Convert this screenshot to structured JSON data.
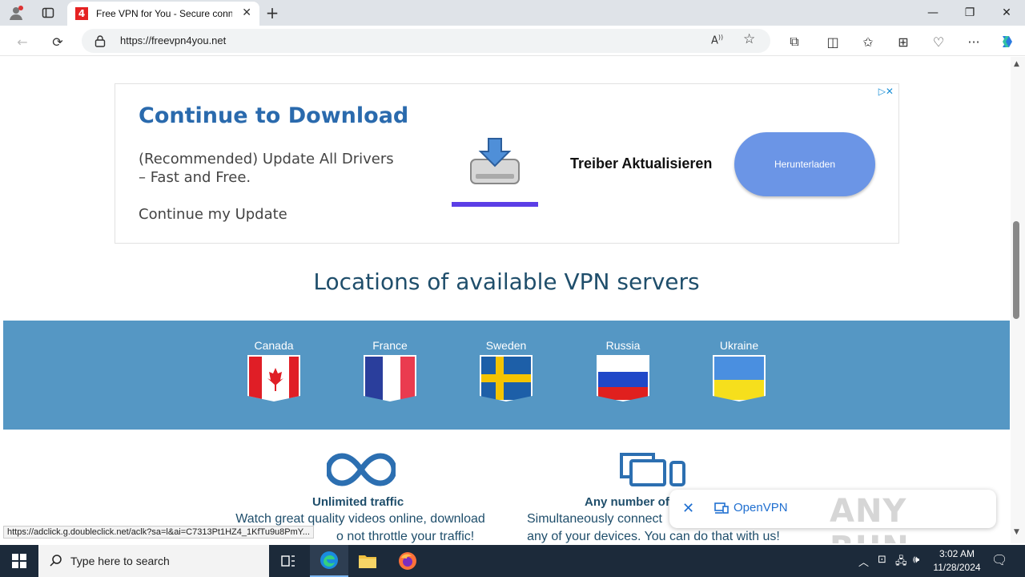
{
  "browser": {
    "tab_title": "Free VPN for You - Secure conne",
    "tab_favicon": "4",
    "url": "https://freevpn4you.net"
  },
  "ad": {
    "title": "Continue to Download",
    "description": "(Recommended) Update All Drivers – Fast and Free.",
    "link": "Continue my Update",
    "driver_text": "Treiber Aktualisieren",
    "button_label": "Herunterladen",
    "adchoices": "▷✕"
  },
  "locations": {
    "heading": "Locations of available VPN servers",
    "flags": [
      {
        "label": "Canada"
      },
      {
        "label": "France"
      },
      {
        "label": "Sweden"
      },
      {
        "label": "Russia"
      },
      {
        "label": "Ukraine"
      }
    ]
  },
  "features": [
    {
      "title": "Unlimited traffic",
      "desc_line1": "Watch great quality videos online, download",
      "desc_line2": "o not throttle your traffic!"
    },
    {
      "title": "Any number of",
      "desc_line1": "Simultaneously connect",
      "desc_line2": "any of your devices. You can do that with us!"
    }
  ],
  "status_url": "https://adclick.g.doubleclick.net/aclk?sa=l&ai=C7313Pt1HZ4_1KfTu9u8PmY...",
  "download_popup": {
    "label": "OpenVPN",
    "watermark": "ANY RUN"
  },
  "taskbar": {
    "search_placeholder": "Type here to search",
    "time": "3:02 AM",
    "date": "11/28/2024"
  },
  "colors": {
    "flag_band": "#5597c4",
    "heading": "#1f4e6b",
    "ad_title": "#2a6aad",
    "ad_button": "#6b95e6"
  }
}
